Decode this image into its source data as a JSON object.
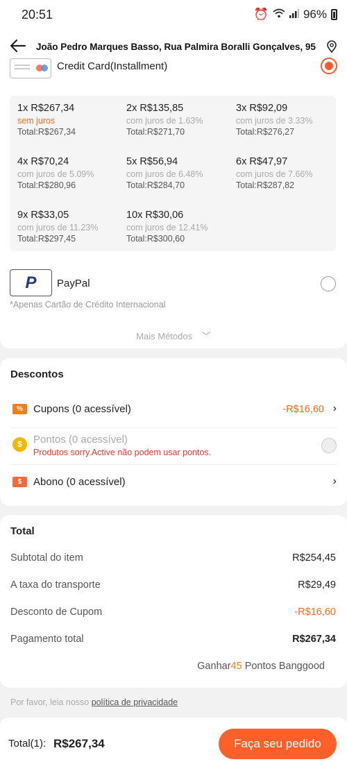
{
  "status": {
    "time": "20:51",
    "battery": "96%"
  },
  "header": {
    "address": "João Pedro Marques Basso, Rua Palmira Boralli Gonçalves, 95"
  },
  "payment": {
    "credit_card_label": "Credit Card(Installment)",
    "installments": [
      {
        "title": "1x R$267,34",
        "rate": "sem juros",
        "total": "Total:R$267,34"
      },
      {
        "title": "2x R$135,85",
        "rate": "com juros de 1.63%",
        "total": "Total:R$271,70"
      },
      {
        "title": "3x R$92,09",
        "rate": "com juros de 3.33%",
        "total": "Total:R$276,27"
      },
      {
        "title": "4x R$70,24",
        "rate": "com juros de 5.09%",
        "total": "Total:R$280,96"
      },
      {
        "title": "5x R$56,94",
        "rate": "com juros de 6.48%",
        "total": "Total:R$284,70"
      },
      {
        "title": "6x R$47,97",
        "rate": "com juros de 7.66%",
        "total": "Total:R$287,82"
      },
      {
        "title": "9x R$33,05",
        "rate": "com juros de 11.23%",
        "total": "Total:R$297,45"
      },
      {
        "title": "10x R$30,06",
        "rate": "com juros de 12.41%",
        "total": "Total:R$300,60"
      }
    ],
    "paypal_logo": "P",
    "paypal_label": "PayPal",
    "paypal_note": "*Apenas Cartão de Crédito  Internacional",
    "more_methods": "Mais Métodos"
  },
  "discounts": {
    "title": "Descontos",
    "coupons_icon": "%",
    "coupons_label": "Cupons (0 acessível)",
    "coupons_value": "-R$16,60",
    "points_icon": "$",
    "points_label": "Pontos (0 acessível)",
    "points_note": "Produtos sorry.Active não podem usar pontos.",
    "abono_icon": "$",
    "abono_label": "Abono (0 acessível)"
  },
  "total": {
    "title": "Total",
    "subtotal_label": "Subtotal do item",
    "subtotal_value": "R$254,45",
    "shipping_label": "A taxa do transporte",
    "shipping_value": "R$29,49",
    "coupon_label": "Desconto de Cupom",
    "coupon_value": "-R$16,60",
    "payment_label": "Pagamento total",
    "payment_value": "R$267,34",
    "earn_prefix": "Ganhar",
    "earn_points": "45",
    "earn_suffix": " Pontos Banggood"
  },
  "privacy": {
    "prefix": "Por favor, leia nosso ",
    "link": "política de privacidade"
  },
  "footer": {
    "total_label": "Total(1):",
    "total_value": "R$267,34",
    "order_button": "Faça seu pedido"
  },
  "colors": {
    "accent": "#ff5f28",
    "orange_text": "#ff6a1a",
    "warning_red": "#e53a2b"
  }
}
